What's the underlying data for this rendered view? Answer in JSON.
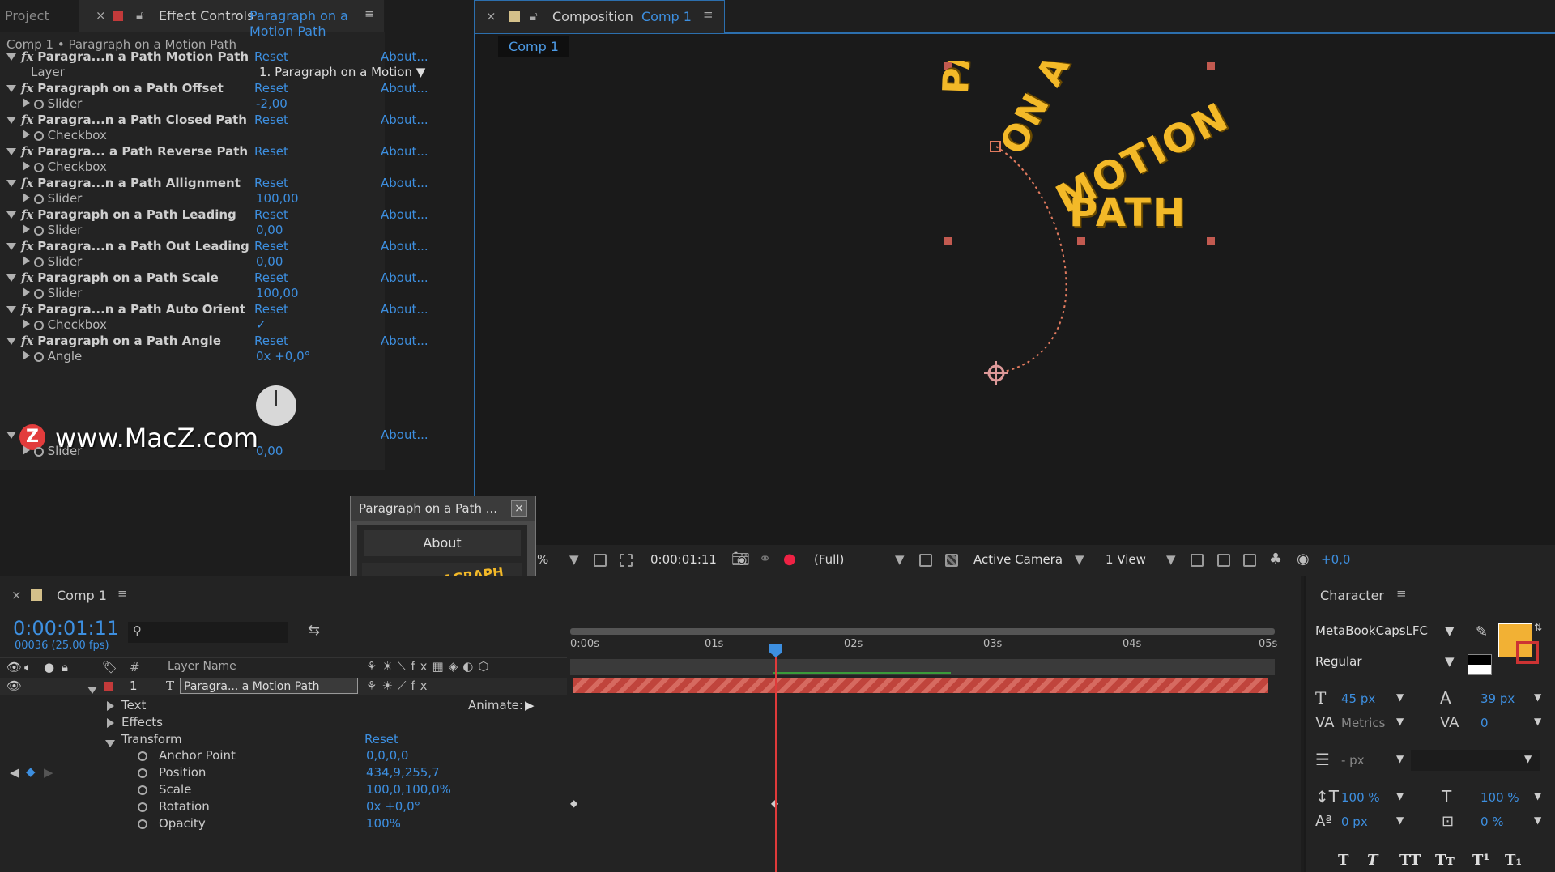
{
  "effect_controls": {
    "project_tab": "Project",
    "tab_label": "Effect Controls",
    "tab_target": "Paragraph on a Motion Path",
    "breadcrumb": "Comp 1 • Paragraph on a Motion Path",
    "layer_label": "Layer",
    "layer_value": "1. Paragraph on a Motion",
    "reset": "Reset",
    "about": "About...",
    "effects": [
      {
        "name": "Paragra...n a Path Motion Path",
        "sub": "",
        "value": ""
      },
      {
        "name": "Paragraph on a Path Offset",
        "sub": "Slider",
        "value": "-2,00"
      },
      {
        "name": "Paragra...n a Path Closed Path",
        "sub": "Checkbox",
        "value": ""
      },
      {
        "name": "Paragra... a Path Reverse Path",
        "sub": "Checkbox",
        "value": ""
      },
      {
        "name": "Paragra...n a Path Allignment",
        "sub": "Slider",
        "value": "100,00"
      },
      {
        "name": "Paragraph on a Path Leading",
        "sub": "Slider",
        "value": "0,00"
      },
      {
        "name": "Paragra...n a Path Out Leading",
        "sub": "Slider",
        "value": "0,00"
      },
      {
        "name": "Paragraph on a Path Scale",
        "sub": "Slider",
        "value": "100,00"
      },
      {
        "name": "Paragra...n a Path Auto Orient",
        "sub": "Checkbox",
        "value": "✓"
      },
      {
        "name": "Paragraph on a Path Angle",
        "sub": "Angle",
        "value": "0x +0,0°"
      }
    ],
    "last_slider_label": "Slider",
    "last_slider_value": "0,00",
    "watermark": "www.MacZ.com"
  },
  "dialog": {
    "title": "Paragraph on a Path ...",
    "about_button": "About",
    "logo_text": "PARAGRAPH ON A PATH"
  },
  "composition": {
    "tab_label": "Composition",
    "tab_target": "Comp 1",
    "sub_tab": "Comp 1",
    "canvas_words": [
      "PAR",
      "ON A",
      "MOTION",
      "PATH"
    ],
    "toolbar": {
      "zoom": "%",
      "timecode": "0:00:01:11",
      "resolution": "(Full)",
      "camera": "Active Camera",
      "views": "1 View",
      "exposure": "+0,0"
    }
  },
  "timeline": {
    "tab": "Comp 1",
    "timecode": "0:00:01:11",
    "frame_info": "00036 (25.00 fps)",
    "ruler": [
      "0:00s",
      "01s",
      "02s",
      "03s",
      "04s",
      "05s"
    ],
    "layer_name_header": "Layer Name",
    "hash_header": "#",
    "layer": {
      "index": "1",
      "name": "Paragra... a Motion Path"
    },
    "animate_label": "Animate:",
    "groups": [
      "Text",
      "Effects",
      "Transform"
    ],
    "transform_reset": "Reset",
    "properties": [
      {
        "name": "Anchor Point",
        "value": "0,0,0,0"
      },
      {
        "name": "Position",
        "value": "434,9,255,7"
      },
      {
        "name": "Scale",
        "value": "100,0,100,0%"
      },
      {
        "name": "Rotation",
        "value": "0x +0,0°"
      },
      {
        "name": "Opacity",
        "value": "100%"
      }
    ]
  },
  "character": {
    "tab": "Character",
    "font": "MetaBookCapsLFC",
    "style": "Regular",
    "size": "45 px",
    "leading": "39 px",
    "kerning": "Metrics",
    "tracking": "0",
    "stroke": "- px",
    "vscale": "100 %",
    "hscale": "100 %",
    "baseline": "0 px",
    "tsume": "0 %",
    "fill_color": "#f2b134",
    "text_buttons": [
      "T",
      "T",
      "TT",
      "Tт",
      "T¹",
      "T₁"
    ]
  }
}
